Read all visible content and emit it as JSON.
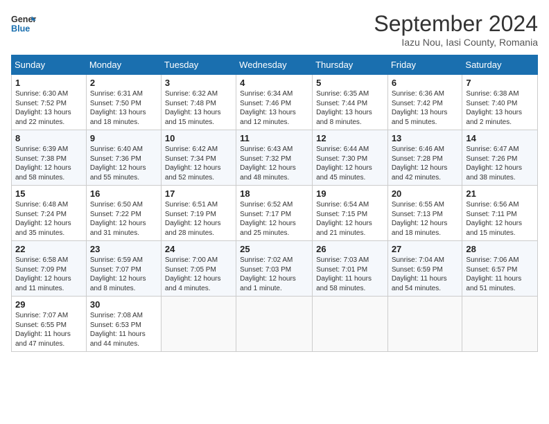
{
  "header": {
    "logo_line1": "General",
    "logo_line2": "Blue",
    "month_title": "September 2024",
    "subtitle": "Iazu Nou, Iasi County, Romania"
  },
  "weekdays": [
    "Sunday",
    "Monday",
    "Tuesday",
    "Wednesday",
    "Thursday",
    "Friday",
    "Saturday"
  ],
  "weeks": [
    [
      {
        "day": "1",
        "sunrise": "6:30 AM",
        "sunset": "7:52 PM",
        "daylight": "13 hours and 22 minutes."
      },
      {
        "day": "2",
        "sunrise": "6:31 AM",
        "sunset": "7:50 PM",
        "daylight": "13 hours and 18 minutes."
      },
      {
        "day": "3",
        "sunrise": "6:32 AM",
        "sunset": "7:48 PM",
        "daylight": "13 hours and 15 minutes."
      },
      {
        "day": "4",
        "sunrise": "6:34 AM",
        "sunset": "7:46 PM",
        "daylight": "13 hours and 12 minutes."
      },
      {
        "day": "5",
        "sunrise": "6:35 AM",
        "sunset": "7:44 PM",
        "daylight": "13 hours and 8 minutes."
      },
      {
        "day": "6",
        "sunrise": "6:36 AM",
        "sunset": "7:42 PM",
        "daylight": "13 hours and 5 minutes."
      },
      {
        "day": "7",
        "sunrise": "6:38 AM",
        "sunset": "7:40 PM",
        "daylight": "13 hours and 2 minutes."
      }
    ],
    [
      {
        "day": "8",
        "sunrise": "6:39 AM",
        "sunset": "7:38 PM",
        "daylight": "12 hours and 58 minutes."
      },
      {
        "day": "9",
        "sunrise": "6:40 AM",
        "sunset": "7:36 PM",
        "daylight": "12 hours and 55 minutes."
      },
      {
        "day": "10",
        "sunrise": "6:42 AM",
        "sunset": "7:34 PM",
        "daylight": "12 hours and 52 minutes."
      },
      {
        "day": "11",
        "sunrise": "6:43 AM",
        "sunset": "7:32 PM",
        "daylight": "12 hours and 48 minutes."
      },
      {
        "day": "12",
        "sunrise": "6:44 AM",
        "sunset": "7:30 PM",
        "daylight": "12 hours and 45 minutes."
      },
      {
        "day": "13",
        "sunrise": "6:46 AM",
        "sunset": "7:28 PM",
        "daylight": "12 hours and 42 minutes."
      },
      {
        "day": "14",
        "sunrise": "6:47 AM",
        "sunset": "7:26 PM",
        "daylight": "12 hours and 38 minutes."
      }
    ],
    [
      {
        "day": "15",
        "sunrise": "6:48 AM",
        "sunset": "7:24 PM",
        "daylight": "12 hours and 35 minutes."
      },
      {
        "day": "16",
        "sunrise": "6:50 AM",
        "sunset": "7:22 PM",
        "daylight": "12 hours and 31 minutes."
      },
      {
        "day": "17",
        "sunrise": "6:51 AM",
        "sunset": "7:19 PM",
        "daylight": "12 hours and 28 minutes."
      },
      {
        "day": "18",
        "sunrise": "6:52 AM",
        "sunset": "7:17 PM",
        "daylight": "12 hours and 25 minutes."
      },
      {
        "day": "19",
        "sunrise": "6:54 AM",
        "sunset": "7:15 PM",
        "daylight": "12 hours and 21 minutes."
      },
      {
        "day": "20",
        "sunrise": "6:55 AM",
        "sunset": "7:13 PM",
        "daylight": "12 hours and 18 minutes."
      },
      {
        "day": "21",
        "sunrise": "6:56 AM",
        "sunset": "7:11 PM",
        "daylight": "12 hours and 15 minutes."
      }
    ],
    [
      {
        "day": "22",
        "sunrise": "6:58 AM",
        "sunset": "7:09 PM",
        "daylight": "12 hours and 11 minutes."
      },
      {
        "day": "23",
        "sunrise": "6:59 AM",
        "sunset": "7:07 PM",
        "daylight": "12 hours and 8 minutes."
      },
      {
        "day": "24",
        "sunrise": "7:00 AM",
        "sunset": "7:05 PM",
        "daylight": "12 hours and 4 minutes."
      },
      {
        "day": "25",
        "sunrise": "7:02 AM",
        "sunset": "7:03 PM",
        "daylight": "12 hours and 1 minute."
      },
      {
        "day": "26",
        "sunrise": "7:03 AM",
        "sunset": "7:01 PM",
        "daylight": "11 hours and 58 minutes."
      },
      {
        "day": "27",
        "sunrise": "7:04 AM",
        "sunset": "6:59 PM",
        "daylight": "11 hours and 54 minutes."
      },
      {
        "day": "28",
        "sunrise": "7:06 AM",
        "sunset": "6:57 PM",
        "daylight": "11 hours and 51 minutes."
      }
    ],
    [
      {
        "day": "29",
        "sunrise": "7:07 AM",
        "sunset": "6:55 PM",
        "daylight": "11 hours and 47 minutes."
      },
      {
        "day": "30",
        "sunrise": "7:08 AM",
        "sunset": "6:53 PM",
        "daylight": "11 hours and 44 minutes."
      },
      null,
      null,
      null,
      null,
      null
    ]
  ]
}
